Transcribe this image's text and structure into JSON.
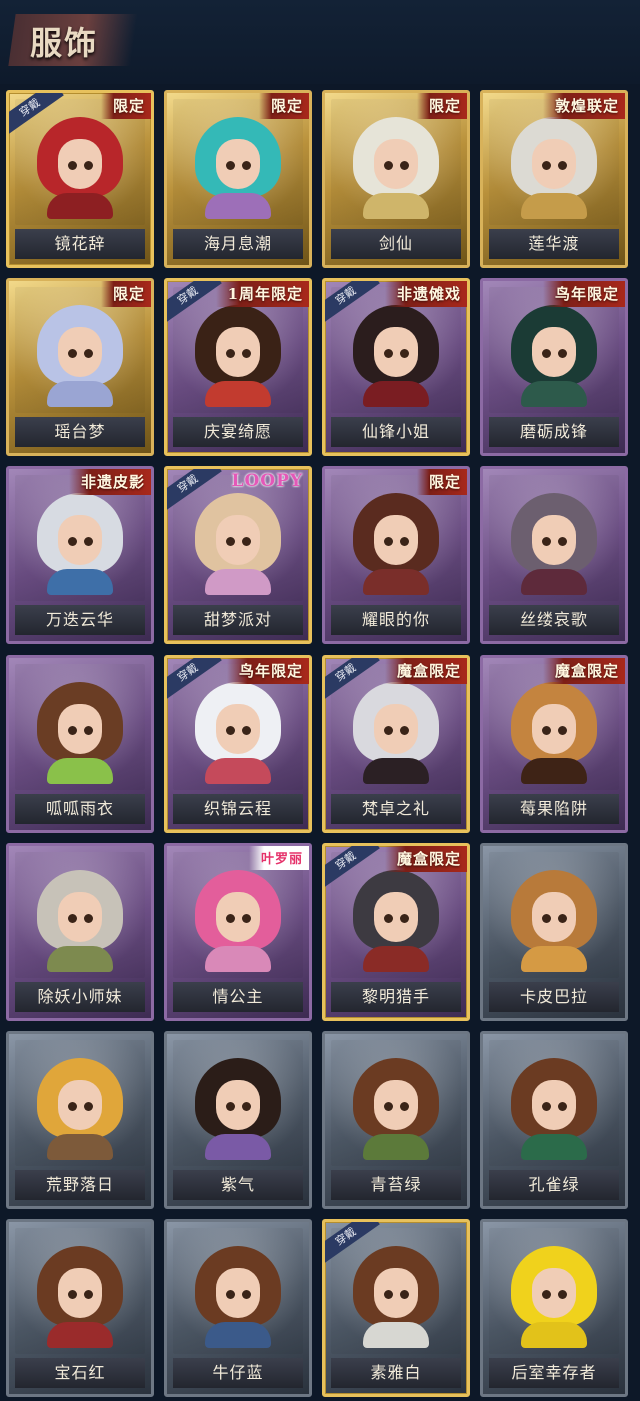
{
  "header": {
    "title": "服饰"
  },
  "worn_label": "穿戴",
  "items": [
    {
      "name": "镜花辞",
      "tag": "限定",
      "tier": "gold",
      "worn": true,
      "hair": "#b8262a",
      "outfit": "#8d1f22"
    },
    {
      "name": "海月息潮",
      "tag": "限定",
      "tier": "gold",
      "worn": false,
      "hair": "#34b9b7",
      "outfit": "#9d6fb8"
    },
    {
      "name": "剑仙",
      "tag": "限定",
      "tier": "gold",
      "worn": false,
      "hair": "#e6e4d8",
      "outfit": "#cfb56a"
    },
    {
      "name": "莲华渡",
      "tag": "敦煌联定",
      "tier": "gold",
      "worn": false,
      "hair": "#dcdad3",
      "outfit": "#c59c4a"
    },
    {
      "name": "瑶台梦",
      "tag": "限定",
      "tier": "gold",
      "worn": false,
      "hair": "#b9c3e6",
      "outfit": "#9aa5d3"
    },
    {
      "name": "庆宴绮愿",
      "tag": "1周年限定",
      "tier": "purple",
      "worn": true,
      "hair": "#3a2216",
      "outfit": "#c23b2f"
    },
    {
      "name": "仙锋小姐",
      "tag": "非遗傩戏",
      "tier": "purple",
      "worn": true,
      "hair": "#2b1d1d",
      "outfit": "#7a1d22"
    },
    {
      "name": "磨砺成锋",
      "tag": "鸟年限定",
      "tier": "purple",
      "worn": false,
      "hair": "#1b3b35",
      "outfit": "#2d5a4b"
    },
    {
      "name": "万迭云华",
      "tag": "非遗皮影",
      "tier": "purple",
      "worn": false,
      "hair": "#d7dbe2",
      "outfit": "#3e6fa8"
    },
    {
      "name": "甜梦派对",
      "tag": "LOOPY",
      "tier": "purple",
      "worn": true,
      "hair": "#e0c3a0",
      "outfit": "#d09ac6"
    },
    {
      "name": "耀眼的你",
      "tag": "限定",
      "tier": "purple",
      "worn": false,
      "hair": "#5a2b1f",
      "outfit": "#7a2e2a"
    },
    {
      "name": "丝缕哀歌",
      "tag": "",
      "tier": "purple",
      "worn": false,
      "hair": "#6c5f6f",
      "outfit": "#5e2a3b"
    },
    {
      "name": "呱呱雨衣",
      "tag": "",
      "tier": "purple",
      "worn": false,
      "hair": "#6a3d24",
      "outfit": "#8ac14a"
    },
    {
      "name": "织锦云程",
      "tag": "鸟年限定",
      "tier": "purple",
      "worn": true,
      "hair": "#eef0f4",
      "outfit": "#c54a5b"
    },
    {
      "name": "梵卓之礼",
      "tag": "魔盒限定",
      "tier": "purple",
      "worn": true,
      "hair": "#d9d9de",
      "outfit": "#2b2024"
    },
    {
      "name": "莓果陷阱",
      "tag": "魔盒限定",
      "tier": "purple",
      "worn": false,
      "hair": "#c4843f",
      "outfit": "#3e2316"
    },
    {
      "name": "除妖小师妹",
      "tag": "",
      "tier": "purple",
      "worn": false,
      "hair": "#c7c2b8",
      "outfit": "#7d8a4f"
    },
    {
      "name": "情公主",
      "tag": "叶罗丽",
      "tier": "purple",
      "worn": false,
      "hair": "#e35e9b",
      "outfit": "#d989b8"
    },
    {
      "name": "黎明猎手",
      "tag": "魔盒限定",
      "tier": "purple",
      "worn": true,
      "hair": "#3d3a41",
      "outfit": "#8a2b26"
    },
    {
      "name": "卡皮巴拉",
      "tag": "",
      "tier": "gray",
      "worn": false,
      "hair": "#b87a3a",
      "outfit": "#d59a44"
    },
    {
      "name": "荒野落日",
      "tag": "",
      "tier": "gray",
      "worn": false,
      "hair": "#e0a63a",
      "outfit": "#7d5a3a"
    },
    {
      "name": "紫气",
      "tag": "",
      "tier": "gray",
      "worn": false,
      "hair": "#2b1d18",
      "outfit": "#7a5aa6"
    },
    {
      "name": "青苔绿",
      "tag": "",
      "tier": "gray",
      "worn": false,
      "hair": "#6b3b22",
      "outfit": "#5c7a3a"
    },
    {
      "name": "孔雀绿",
      "tag": "",
      "tier": "gray",
      "worn": false,
      "hair": "#6b3b22",
      "outfit": "#2b6b4a"
    },
    {
      "name": "宝石红",
      "tag": "",
      "tier": "gray",
      "worn": false,
      "hair": "#6b3b22",
      "outfit": "#9a2b2b"
    },
    {
      "name": "牛仔蓝",
      "tag": "",
      "tier": "gray",
      "worn": false,
      "hair": "#6b3b22",
      "outfit": "#3b5a8a"
    },
    {
      "name": "素雅白",
      "tag": "",
      "tier": "gray",
      "worn": true,
      "hair": "#6b3b22",
      "outfit": "#d7d7d2"
    },
    {
      "name": "后室幸存者",
      "tag": "",
      "tier": "gray",
      "worn": false,
      "hair": "#f0d21c",
      "outfit": "#e2c21a"
    }
  ]
}
